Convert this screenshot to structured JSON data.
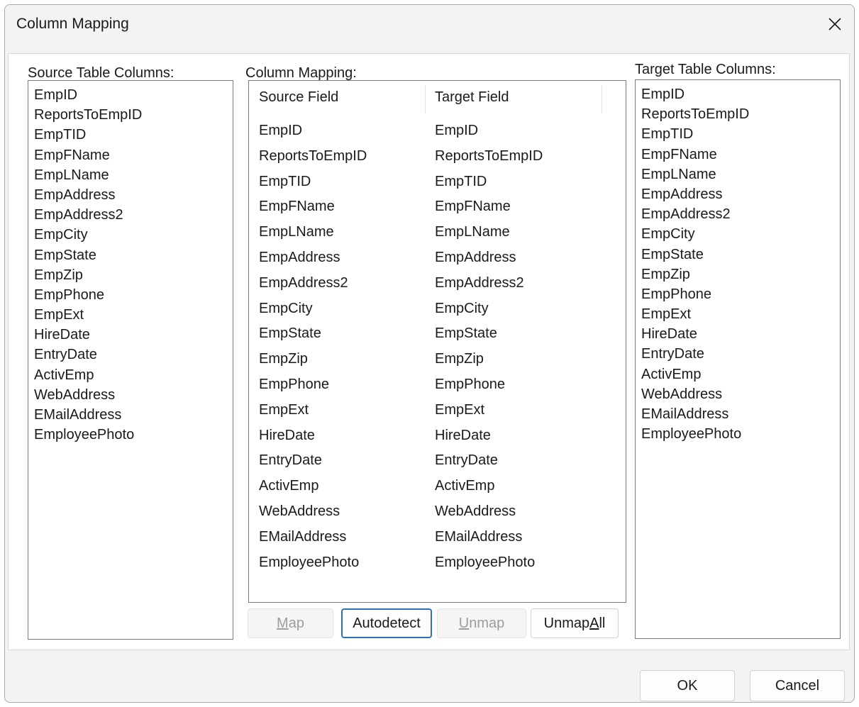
{
  "window": {
    "title": "Column Mapping"
  },
  "source": {
    "label": "Source Table Columns:",
    "items": [
      "EmpID",
      "ReportsToEmpID",
      "EmpTID",
      "EmpFName",
      "EmpLName",
      "EmpAddress",
      "EmpAddress2",
      "EmpCity",
      "EmpState",
      "EmpZip",
      "EmpPhone",
      "EmpExt",
      "HireDate",
      "EntryDate",
      "ActivEmp",
      "WebAddress",
      "EMailAddress",
      "EmployeePhoto"
    ]
  },
  "mapping": {
    "label": "Column Mapping:",
    "headers": {
      "source": "Source Field",
      "target": "Target Field"
    },
    "rows": [
      {
        "source": "EmpID",
        "target": "EmpID"
      },
      {
        "source": "ReportsToEmpID",
        "target": "ReportsToEmpID"
      },
      {
        "source": "EmpTID",
        "target": "EmpTID"
      },
      {
        "source": "EmpFName",
        "target": "EmpFName"
      },
      {
        "source": "EmpLName",
        "target": "EmpLName"
      },
      {
        "source": "EmpAddress",
        "target": "EmpAddress"
      },
      {
        "source": "EmpAddress2",
        "target": "EmpAddress2"
      },
      {
        "source": "EmpCity",
        "target": "EmpCity"
      },
      {
        "source": "EmpState",
        "target": "EmpState"
      },
      {
        "source": "EmpZip",
        "target": "EmpZip"
      },
      {
        "source": "EmpPhone",
        "target": "EmpPhone"
      },
      {
        "source": "EmpExt",
        "target": "EmpExt"
      },
      {
        "source": "HireDate",
        "target": "HireDate"
      },
      {
        "source": "EntryDate",
        "target": "EntryDate"
      },
      {
        "source": "ActivEmp",
        "target": "ActivEmp"
      },
      {
        "source": "WebAddress",
        "target": "WebAddress"
      },
      {
        "source": "EMailAddress",
        "target": "EMailAddress"
      },
      {
        "source": "EmployeePhoto",
        "target": "EmployeePhoto"
      }
    ],
    "buttons": {
      "map": {
        "pre": "",
        "ul": "M",
        "post": "ap"
      },
      "autodetect": {
        "pre": "Autodetect",
        "ul": "",
        "post": ""
      },
      "unmap": {
        "pre": "",
        "ul": "U",
        "post": "nmap"
      },
      "unmap_all": {
        "pre": "Unmap ",
        "ul": "A",
        "post": "ll"
      }
    }
  },
  "target": {
    "label": "Target Table Columns:",
    "items": [
      "EmpID",
      "ReportsToEmpID",
      "EmpTID",
      "EmpFName",
      "EmpLName",
      "EmpAddress",
      "EmpAddress2",
      "EmpCity",
      "EmpState",
      "EmpZip",
      "EmpPhone",
      "EmpExt",
      "HireDate",
      "EntryDate",
      "ActivEmp",
      "WebAddress",
      "EMailAddress",
      "EmployeePhoto"
    ]
  },
  "footer": {
    "ok": "OK",
    "cancel": "Cancel"
  }
}
